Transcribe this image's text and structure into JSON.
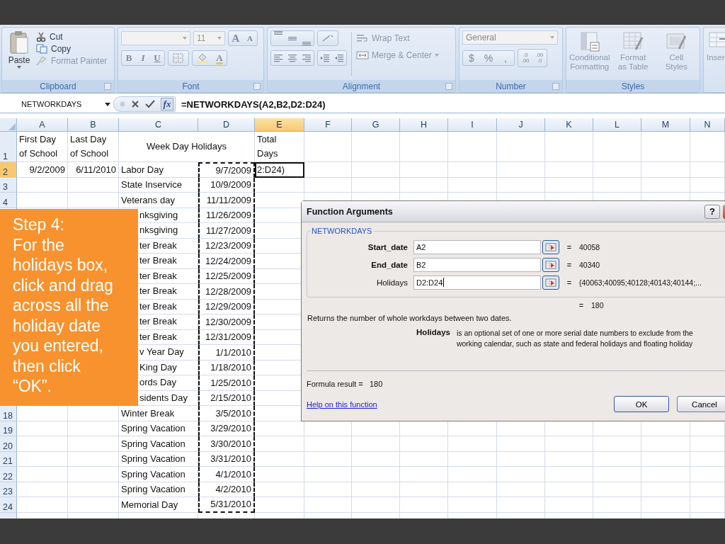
{
  "clipboard": {
    "paste": "Paste",
    "label": "Clipboard",
    "items": [
      {
        "kind": "cut",
        "label": "Cut",
        "disabled": false
      },
      {
        "kind": "copy",
        "label": "Copy",
        "disabled": false
      },
      {
        "kind": "painter",
        "label": "Format Painter",
        "disabled": true
      }
    ]
  },
  "font": {
    "label": "Font",
    "size": "11",
    "grow": "A",
    "shrink": "A",
    "bold": "B",
    "italic": "I",
    "underline": "U",
    "font_color_letter": "A"
  },
  "alignment": {
    "label": "Alignment",
    "wrap": "Wrap Text",
    "merge": "Merge & Center"
  },
  "number": {
    "label": "Number",
    "format": "General",
    "currency": "$",
    "percent": "%",
    "comma": ",",
    "increase": [
      ".0",
      ".00"
    ],
    "decrease": [
      ".00",
      ".0"
    ]
  },
  "styles": {
    "label": "Styles",
    "buttons": [
      {
        "kind": "conditional",
        "label": "Conditional\nFormatting"
      },
      {
        "kind": "table",
        "label": "Format\nas Table"
      },
      {
        "kind": "cell",
        "label": "Cell\nStyles"
      }
    ]
  },
  "cells": {
    "insert": "Inser"
  },
  "formula_bar": {
    "name_box": "NETWORKDAYS",
    "fx": "fx",
    "formula": "=NETWORKDAYS(A2,B2,D2:D24)"
  },
  "sheet": {
    "columns": [
      {
        "label": "A",
        "selected": false
      },
      {
        "label": "B",
        "selected": false
      },
      {
        "label": "C",
        "selected": false
      },
      {
        "label": "D",
        "selected": false
      },
      {
        "label": "E",
        "selected": true
      },
      {
        "label": "F",
        "selected": false
      },
      {
        "label": "G",
        "selected": false
      },
      {
        "label": "H",
        "selected": false
      },
      {
        "label": "I",
        "selected": false
      },
      {
        "label": "J",
        "selected": false
      },
      {
        "label": "K",
        "selected": false
      },
      {
        "label": "L",
        "selected": false
      },
      {
        "label": "M",
        "selected": false
      },
      {
        "label": "N",
        "selected": false
      }
    ],
    "rows": [
      {
        "kind": "header",
        "number": "1",
        "selected": false,
        "a": "First Day\nof School",
        "b": "Last Day\nof School",
        "cd": "Week Day Holidays",
        "e": "Total\nDays"
      },
      {
        "kind": "data",
        "number": "2",
        "selected": true,
        "in_range": true,
        "a": "9/2/2009",
        "b": "6/11/2010",
        "c": "Labor Day",
        "d": "9/7/2009",
        "e": "2:D24)"
      },
      {
        "kind": "data",
        "number": "3",
        "selected": false,
        "in_range": true,
        "c": "State Inservice",
        "d": "10/9/2009"
      },
      {
        "kind": "data",
        "number": "4",
        "selected": false,
        "in_range": true,
        "c": "Veterans day",
        "d": "11/11/2009"
      },
      {
        "kind": "data",
        "under_callout": true,
        "in_range": true,
        "c": "nksgiving",
        "d": "11/26/2009"
      },
      {
        "kind": "data",
        "under_callout": true,
        "in_range": true,
        "c": "nksgiving",
        "d": "11/27/2009"
      },
      {
        "kind": "data",
        "under_callout": true,
        "in_range": true,
        "c": "ter Break",
        "d": "12/23/2009"
      },
      {
        "kind": "data",
        "under_callout": true,
        "in_range": true,
        "c": "ter Break",
        "d": "12/24/2009"
      },
      {
        "kind": "data",
        "under_callout": true,
        "in_range": true,
        "c": "ter Break",
        "d": "12/25/2009"
      },
      {
        "kind": "data",
        "under_callout": true,
        "in_range": true,
        "c": "ter Break",
        "d": "12/28/2009"
      },
      {
        "kind": "data",
        "under_callout": true,
        "in_range": true,
        "c": "ter Break",
        "d": "12/29/2009"
      },
      {
        "kind": "data",
        "under_callout": true,
        "in_range": true,
        "c": "ter Break",
        "d": "12/30/2009"
      },
      {
        "kind": "data",
        "under_callout": true,
        "in_range": true,
        "c": "ter Break",
        "d": "12/31/2009"
      },
      {
        "kind": "data",
        "under_callout": true,
        "in_range": true,
        "c": "v Year Day",
        "d": "1/1/2010"
      },
      {
        "kind": "data",
        "under_callout": true,
        "in_range": true,
        "c": "King Day",
        "d": "1/18/2010"
      },
      {
        "kind": "data",
        "under_callout": true,
        "in_range": true,
        "c": "ords Day",
        "d": "1/25/2010"
      },
      {
        "kind": "data",
        "under_callout": true,
        "in_range": true,
        "c": "sidents Day",
        "d": "2/15/2010"
      },
      {
        "kind": "data",
        "number": "18",
        "selected": false,
        "in_range": true,
        "c": "Winter Break",
        "d": "3/5/2010"
      },
      {
        "kind": "data",
        "number": "19",
        "selected": false,
        "in_range": true,
        "c": "Spring Vacation",
        "d": "3/29/2010"
      },
      {
        "kind": "data",
        "number": "20",
        "selected": false,
        "in_range": true,
        "c": "Spring Vacation",
        "d": "3/30/2010"
      },
      {
        "kind": "data",
        "number": "21",
        "selected": false,
        "in_range": true,
        "c": "Spring Vacation",
        "d": "3/31/2010"
      },
      {
        "kind": "data",
        "number": "22",
        "selected": false,
        "in_range": true,
        "c": "Spring Vacation",
        "d": "4/1/2010"
      },
      {
        "kind": "data",
        "number": "23",
        "selected": false,
        "in_range": true,
        "c": "Spring Vacation",
        "d": "4/2/2010"
      },
      {
        "kind": "data",
        "number": "24",
        "selected": false,
        "in_range": true,
        "c": "Memorial Day",
        "d": "5/31/2010"
      },
      {
        "kind": "data",
        "selected": false,
        "in_range": false
      }
    ]
  },
  "callout": {
    "text": "Step 4:\nFor the\nholidays box,\nclick and drag\nacross all the\nholiday date\nyou entered,\nthen click\n“OK”."
  },
  "dialog": {
    "title": "Function Arguments",
    "help": "?",
    "function": "NETWORKDAYS",
    "arguments": [
      {
        "label": "Start_date",
        "required": true,
        "value": "A2",
        "result": "40058"
      },
      {
        "label": "End_date",
        "required": true,
        "value": "B2",
        "result": "40340"
      },
      {
        "label": "Holidays",
        "required": false,
        "value": "D2:D24",
        "result": "{40063;40095;40128;40143;40144;..."
      }
    ],
    "equals": "=",
    "function_result": "180",
    "description": "Returns the number of whole workdays between two dates.",
    "arg_name": "Holidays",
    "arg_help": "is an optional set of one or more serial date numbers to exclude from the\nworking calendar, such as state and federal holidays and floating holiday",
    "formula_result_label": "Formula result =",
    "formula_result": "180",
    "help_link": "Help on this function",
    "ok": "OK",
    "cancel": "Cancel"
  }
}
